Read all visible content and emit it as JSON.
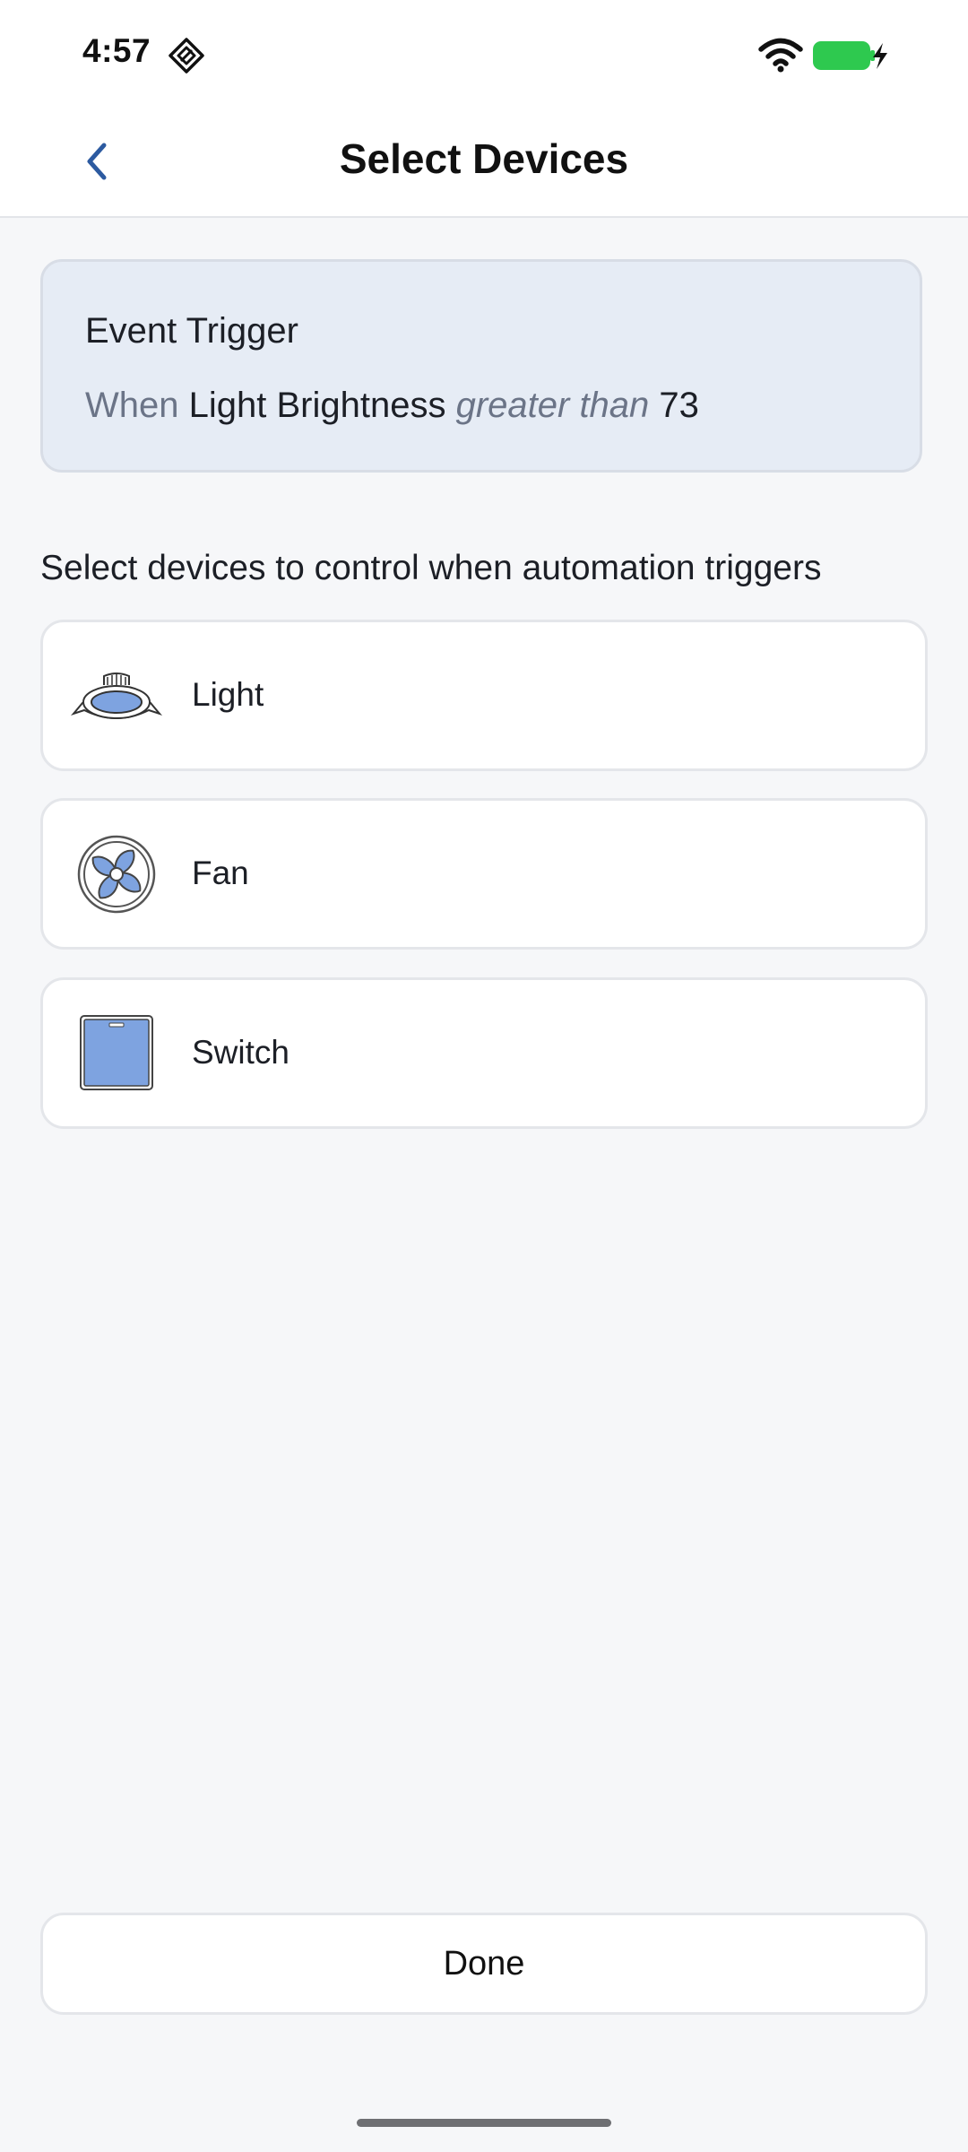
{
  "status_bar": {
    "time": "4:57",
    "icons": [
      "diamond-app-icon",
      "wifi-icon",
      "battery-charging-icon"
    ],
    "battery_color": "#2ec94f"
  },
  "header": {
    "back_icon": "chevron-left-icon",
    "title": "Select Devices",
    "accent_color": "#2c5aa0"
  },
  "trigger": {
    "heading": "Event Trigger",
    "when": "When",
    "subject": "Light Brightness",
    "operator": "greater than",
    "value": "73"
  },
  "section_label": "Select devices to control when automation triggers",
  "devices": [
    {
      "label": "Light",
      "icon": "ceiling-light-icon"
    },
    {
      "label": "Fan",
      "icon": "fan-icon"
    },
    {
      "label": "Switch",
      "icon": "wall-switch-icon"
    }
  ],
  "done_label": "Done"
}
